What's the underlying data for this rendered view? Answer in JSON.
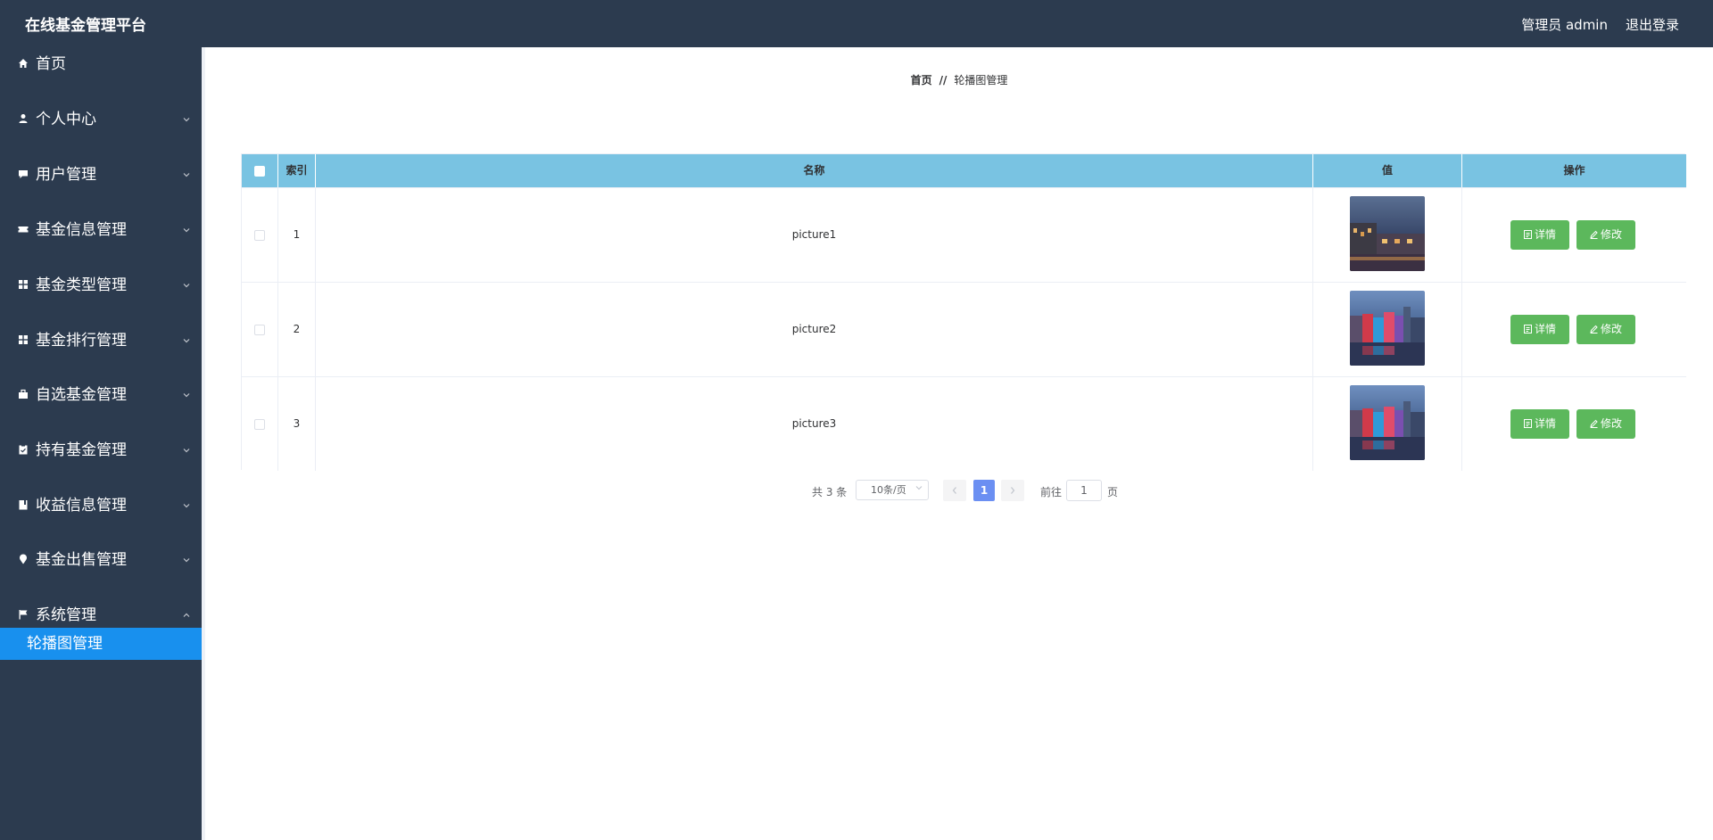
{
  "header": {
    "brand": "在线基金管理平台",
    "user": "管理员 admin",
    "logout": "退出登录"
  },
  "sidebar": {
    "items": [
      {
        "label": "首页",
        "icon": "home-icon"
      },
      {
        "label": "个人中心",
        "icon": "user-icon"
      },
      {
        "label": "用户管理",
        "icon": "chat-icon"
      },
      {
        "label": "基金信息管理",
        "icon": "ticket-icon"
      },
      {
        "label": "基金类型管理",
        "icon": "grid-icon"
      },
      {
        "label": "基金排行管理",
        "icon": "grid-icon"
      },
      {
        "label": "自选基金管理",
        "icon": "briefcase-icon"
      },
      {
        "label": "持有基金管理",
        "icon": "clipboard-icon"
      },
      {
        "label": "收益信息管理",
        "icon": "book-icon"
      },
      {
        "label": "基金出售管理",
        "icon": "location-icon"
      },
      {
        "label": "系统管理",
        "icon": "flag-icon"
      }
    ],
    "active_sub": "轮播图管理"
  },
  "breadcrumb": {
    "home": "首页",
    "sep": "//",
    "current": "轮播图管理"
  },
  "table": {
    "columns": [
      "索引",
      "名称",
      "值",
      "操作"
    ],
    "rows": [
      {
        "index": "1",
        "name": "picture1"
      },
      {
        "index": "2",
        "name": "picture2"
      },
      {
        "index": "3",
        "name": "picture3"
      }
    ],
    "detail_label": "详情",
    "edit_label": "修改"
  },
  "pagination": {
    "total": "共 3 条",
    "page_size": "10条/页",
    "current": "1",
    "goto": "前往",
    "goto_value": "1",
    "page_unit": "页"
  },
  "colors": {
    "header_bg": "#2c3b4f",
    "sidebar_bg": "#2c3b4f",
    "active_bg": "#1890ee",
    "table_head": "#79c3e2",
    "button": "#5cb85c",
    "pager_active": "#6b8ff2"
  }
}
